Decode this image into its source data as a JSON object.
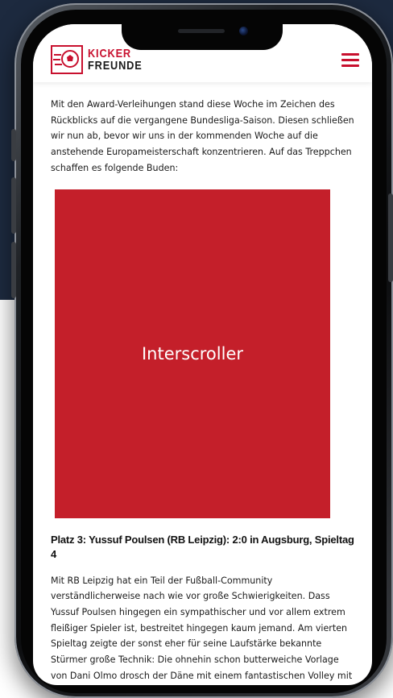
{
  "header": {
    "logo_line1": "KICKER",
    "logo_line2": "FREUNDE"
  },
  "article": {
    "intro": "Mit den Award-Verleihungen stand diese Woche im Zeichen des Rückblicks auf die vergangene Bundesliga-Saison. Diesen schließen wir nun ab, bevor wir uns in der kommenden Woche auf die anstehende Europameisterschaft konzentrieren. Auf das Treppchen schaffen es folgende Buden:",
    "ad_label": "Interscroller",
    "heading": "Platz 3: Yussuf Poulsen (RB Leipzig): 2:0 in Augsburg, Spieltag 4",
    "body": "Mit RB Leipzig hat ein Teil der Fußball-Community verständlicherweise nach wie vor große Schwierigkeiten. Dass Yussuf Poulsen hingegen ein sympathischer und vor allem extrem fleißiger Spieler ist, bestreitet hingegen kaum jemand. Am vierten Spieltag zeigte der sonst eher für seine Laufstärke bekannte Stürmer große Technik: Die ohnehin schon butterweiche Vorlage von Dani Olmo drosch der Däne mit einem fantastischen Volley mit seinem schwächeren linken Fuß in die Maschen. Die Schusstechnik war perfekt, eine ideales Mischverhältnis aus Filigranarbeit und Wucht. Die"
  },
  "colors": {
    "brand_red": "#c8102e",
    "ad_red": "#c41f2a",
    "background_navy": "#1d2a3f"
  },
  "icons": {
    "menu": "hamburger-icon",
    "logo": "soccer-ball-icon"
  }
}
